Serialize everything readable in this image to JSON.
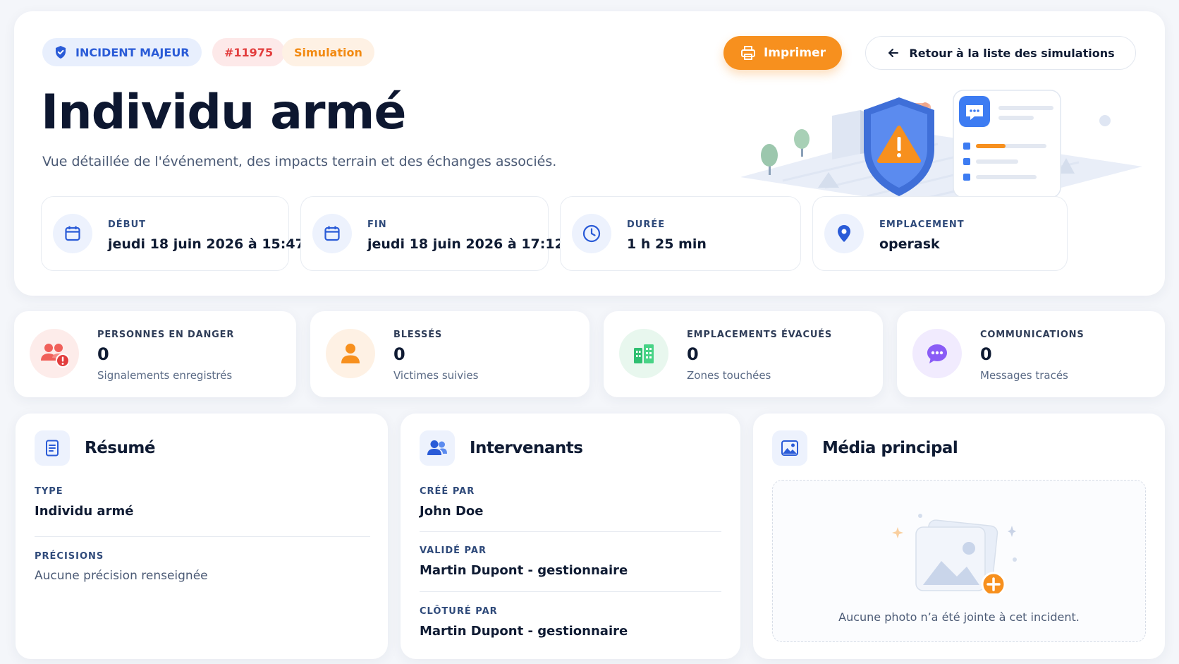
{
  "header": {
    "badge_incident": "INCIDENT MAJEUR",
    "badge_id": "#11975",
    "badge_mode": "Simulation",
    "title": "Individu armé",
    "subtitle": "Vue détaillée de l'événement, des impacts terrain et des échanges associés.",
    "print_label": "Imprimer",
    "back_label": "Retour à la liste des simulations"
  },
  "info": [
    {
      "label": "DÉBUT",
      "value": "jeudi 18 juin 2026 à 15:47",
      "icon": "calendar-icon"
    },
    {
      "label": "FIN",
      "value": "jeudi 18 juin 2026 à 17:12",
      "icon": "calendar-icon"
    },
    {
      "label": "DURÉE",
      "value": "1 h 25 min",
      "icon": "clock-icon"
    },
    {
      "label": "EMPLACEMENT",
      "value": "operask",
      "icon": "location-pin-icon"
    }
  ],
  "stats": [
    {
      "label": "PERSONNES EN DANGER",
      "value": "0",
      "caption": "Signalements enregistrés",
      "icon": "people-alert-icon",
      "color": "#f0605a"
    },
    {
      "label": "BLESSÉS",
      "value": "0",
      "caption": "Victimes suivies",
      "icon": "person-icon",
      "color": "#f7901e"
    },
    {
      "label": "EMPLACEMENTS ÉVACUÉS",
      "value": "0",
      "caption": "Zones touchées",
      "icon": "buildings-icon",
      "color": "#2fbf71"
    },
    {
      "label": "COMMUNICATIONS",
      "value": "0",
      "caption": "Messages tracés",
      "icon": "chat-icon",
      "color": "#8a5cf6"
    }
  ],
  "summary": {
    "title": "Résumé",
    "type_label": "TYPE",
    "type_value": "Individu armé",
    "precisions_label": "PRÉCISIONS",
    "precisions_value": "Aucune précision renseignée"
  },
  "responders": {
    "title": "Intervenants",
    "created_label": "CRÉÉ PAR",
    "created_value": "John Doe",
    "validated_label": "VALIDÉ PAR",
    "validated_value": "Martin Dupont - gestionnaire",
    "closed_label": "CLÔTURÉ PAR",
    "closed_value": "Martin Dupont - gestionnaire"
  },
  "media": {
    "title": "Média principal",
    "empty_text": "Aucune photo n’a été jointe à cet incident."
  },
  "colors": {
    "accent_blue": "#2a5bd7",
    "accent_orange": "#f7901e",
    "danger_red": "#e23d3d"
  }
}
